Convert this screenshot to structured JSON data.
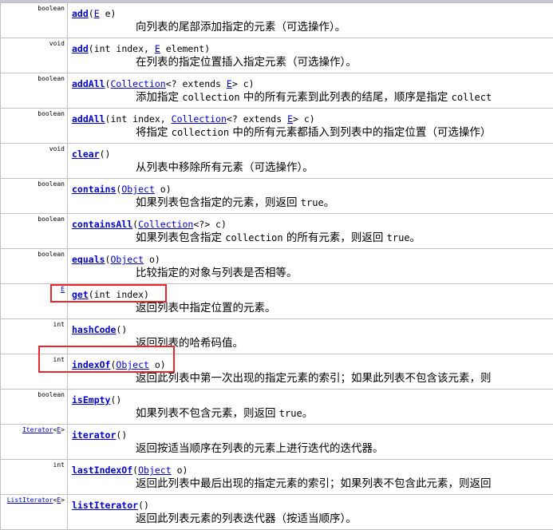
{
  "rows": [
    {
      "ret": "boolean",
      "name": "add",
      "p1": "(",
      "t1": "E",
      "p2": " e)",
      "desc": "向列表的尾部添加指定的元素（可选操作）。"
    },
    {
      "ret": "void",
      "name": "add",
      "p1": "(int index, ",
      "t1": "E",
      "p2": " element)",
      "desc": "在列表的指定位置插入指定元素（可选操作）。"
    },
    {
      "ret": "boolean",
      "name": "addAll",
      "p1": "(",
      "t1": "Collection",
      "p2": "<? extends ",
      "t2": "E",
      "p3": "> c)",
      "desc_a": "添加指定 ",
      "desc_code": "collection",
      "desc_b": " 中的所有元素到此列表的结尾，顺序是指定 ",
      "desc_code2": "collect"
    },
    {
      "ret": "boolean",
      "name": "addAll",
      "p1": "(int index, ",
      "t1": "Collection",
      "p2": "<? extends ",
      "t2": "E",
      "p3": "> c)",
      "desc_a": "将指定 ",
      "desc_code": "collection",
      "desc_b": " 中的所有元素都插入到列表中的指定位置（可选操作）"
    },
    {
      "ret": "void",
      "name": "clear",
      "p1": "()",
      "desc": "从列表中移除所有元素（可选操作）。"
    },
    {
      "ret": "boolean",
      "name": "contains",
      "p1": "(",
      "t1": "Object",
      "p2": " o)",
      "desc_a": "如果列表包含指定的元素，则返回 ",
      "desc_code": "true",
      "desc_b": "。"
    },
    {
      "ret": "boolean",
      "name": "containsAll",
      "p1": "(",
      "t1": "Collection",
      "p2": "<?> c)",
      "desc_a": "如果列表包含指定 ",
      "desc_code": "collection",
      "desc_b": " 的所有元素，则返回 ",
      "desc_code2": "true",
      "desc_c": "。"
    },
    {
      "ret": "boolean",
      "name": "equals",
      "p1": "(",
      "t1": "Object",
      "p2": " o)",
      "desc": "比较指定的对象与列表是否相等。"
    },
    {
      "ret_link": "E",
      "name": "get",
      "p1": "(int index)",
      "desc": "返回列表中指定位置的元素。"
    },
    {
      "ret": "int",
      "name": "hashCode",
      "p1": "()",
      "desc": "返回列表的哈希码值。"
    },
    {
      "ret": "int",
      "name": "indexOf",
      "p1": "(",
      "t1": "Object",
      "p2": " o)",
      "desc": "返回此列表中第一次出现的指定元素的索引；如果此列表不包含该元素，则"
    },
    {
      "ret": "boolean",
      "name": "isEmpty",
      "p1": "()",
      "desc_a": "如果列表不包含元素，则返回 ",
      "desc_code": "true",
      "desc_b": "。"
    },
    {
      "ret_link": "Iterator",
      "ret_lt": "<",
      "ret_link2": "E",
      "ret_gt": ">",
      "name": "iterator",
      "p1": "()",
      "desc": "返回按适当顺序在列表的元素上进行迭代的迭代器。"
    },
    {
      "ret": "int",
      "name": "lastIndexOf",
      "p1": "(",
      "t1": "Object",
      "p2": " o)",
      "desc": "返回此列表中最后出现的指定元素的索引；如果列表不包含此元素，则返回"
    },
    {
      "ret_link": "ListIterator",
      "ret_lt": "<",
      "ret_link2": "E",
      "ret_gt": ">",
      "name": "listIterator",
      "p1": "()",
      "desc": "返回此列表元素的列表迭代器（按适当顺序）。"
    }
  ],
  "highlight_color": "#e8262d",
  "link_color": "#0000cc",
  "grid_color": "#c0c0c0"
}
